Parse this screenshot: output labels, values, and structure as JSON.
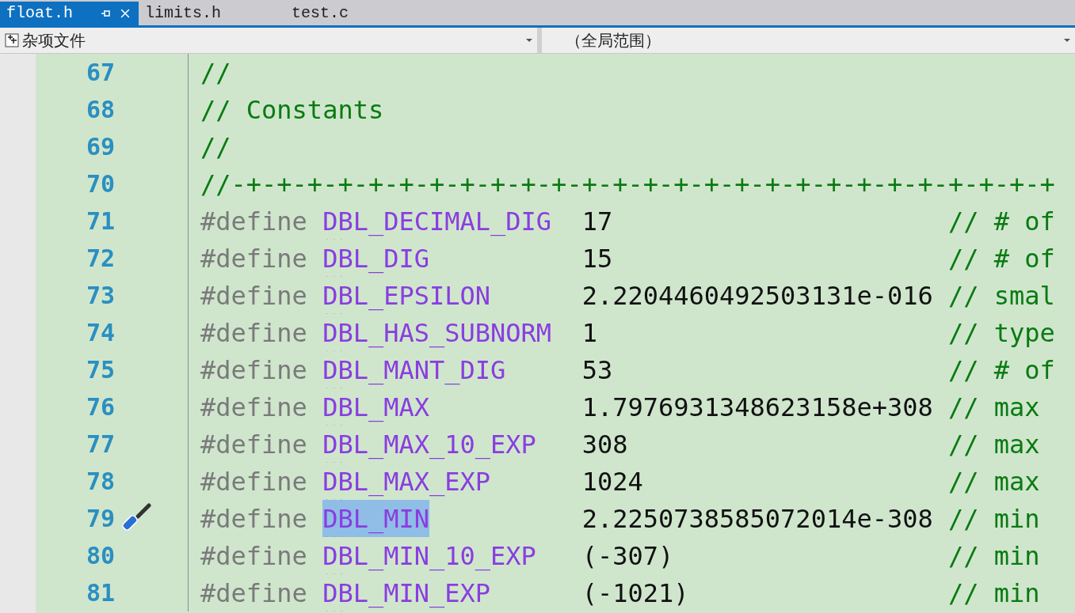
{
  "tabs": [
    {
      "label": "float.h",
      "selected": true
    },
    {
      "label": "limits.h",
      "selected": false
    },
    {
      "label": "test.c",
      "selected": false
    }
  ],
  "navigation": {
    "project": "杂项文件",
    "scope": "（全局范围）"
  },
  "lines": [
    {
      "number": "67",
      "kind": "comment",
      "text": "//",
      "quick_action": false
    },
    {
      "number": "68",
      "kind": "comment",
      "text": "// Constants",
      "quick_action": false
    },
    {
      "number": "69",
      "kind": "comment",
      "text": "//",
      "quick_action": false
    },
    {
      "number": "70",
      "kind": "comment",
      "text": "//-+-+-+-+-+-+-+-+-+-+-+-+-+-+-+-+-+-+-+-+-+-+-+-+-+-+-+",
      "quick_action": false
    },
    {
      "number": "71",
      "kind": "define",
      "keyword": "#define",
      "name": "DBL_DECIMAL_DIG",
      "value": "17",
      "comment": "// # of",
      "highlighted": false,
      "quick_action": false
    },
    {
      "number": "72",
      "kind": "define",
      "keyword": "#define",
      "name": "DBL_DIG",
      "value": "15",
      "comment": "// # of",
      "highlighted": false,
      "quick_action": false
    },
    {
      "number": "73",
      "kind": "define",
      "keyword": "#define",
      "name": "DBL_EPSILON",
      "value": "2.2204460492503131e-016",
      "comment": "// smal",
      "highlighted": false,
      "quick_action": false
    },
    {
      "number": "74",
      "kind": "define",
      "keyword": "#define",
      "name": "DBL_HAS_SUBNORM",
      "value": "1",
      "comment": "// type",
      "highlighted": false,
      "quick_action": false
    },
    {
      "number": "75",
      "kind": "define",
      "keyword": "#define",
      "name": "DBL_MANT_DIG",
      "value": "53",
      "comment": "// # of",
      "highlighted": false,
      "quick_action": false
    },
    {
      "number": "76",
      "kind": "define",
      "keyword": "#define",
      "name": "DBL_MAX",
      "value": "1.7976931348623158e+308",
      "comment": "// max",
      "highlighted": false,
      "quick_action": false
    },
    {
      "number": "77",
      "kind": "define",
      "keyword": "#define",
      "name": "DBL_MAX_10_EXP",
      "value": "308",
      "comment": "// max",
      "highlighted": false,
      "quick_action": false
    },
    {
      "number": "78",
      "kind": "define",
      "keyword": "#define",
      "name": "DBL_MAX_EXP",
      "value": "1024",
      "comment": "// max",
      "highlighted": false,
      "quick_action": false
    },
    {
      "number": "79",
      "kind": "define",
      "keyword": "#define",
      "name": "DBL_MIN",
      "value": "2.2250738585072014e-308",
      "comment": "// min",
      "highlighted": true,
      "quick_action": true
    },
    {
      "number": "80",
      "kind": "define",
      "keyword": "#define",
      "name": "DBL_MIN_10_EXP",
      "value": "(-307)",
      "comment": "// min",
      "highlighted": false,
      "quick_action": false
    },
    {
      "number": "81",
      "kind": "define",
      "keyword": "#define",
      "name": "DBL_MIN_EXP",
      "value": "(-1021)",
      "comment": "// min",
      "highlighted": false,
      "quick_action": false
    }
  ]
}
